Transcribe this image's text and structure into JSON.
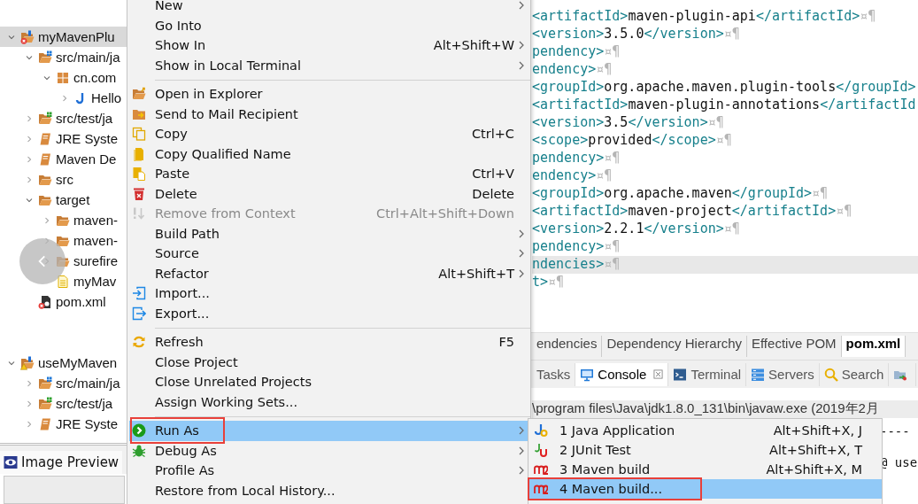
{
  "project_tree": [
    {
      "label": "myMavenPlu",
      "kind": "project",
      "expanded": true,
      "selected": true,
      "error": true,
      "warning": false,
      "children": [
        {
          "label": "src/main/ja",
          "kind": "source",
          "expanded": true,
          "selected": false,
          "error": false,
          "warning": false,
          "children": [
            {
              "label": "cn.com",
              "kind": "package",
              "expanded": true,
              "selected": false,
              "error": false,
              "warning": false,
              "children": [
                {
                  "label": "Hello",
                  "kind": "java",
                  "expanded": false,
                  "selected": false,
                  "error": false,
                  "warning": false
                }
              ]
            }
          ]
        },
        {
          "label": "src/test/ja",
          "kind": "test-source",
          "expanded": false,
          "selected": false,
          "error": false,
          "warning": false
        },
        {
          "label": "JRE Syste",
          "kind": "library",
          "expanded": false,
          "selected": false,
          "error": false,
          "warning": false
        },
        {
          "label": "Maven De",
          "kind": "library",
          "expanded": false,
          "selected": false,
          "error": false,
          "warning": false
        },
        {
          "label": "src",
          "kind": "folder",
          "expanded": false,
          "selected": false,
          "error": false,
          "warning": false
        },
        {
          "label": "target",
          "kind": "folder",
          "expanded": true,
          "selected": false,
          "error": false,
          "warning": false,
          "children": [
            {
              "label": "maven-",
              "kind": "folder",
              "expanded": false,
              "selected": false,
              "error": false,
              "warning": false
            },
            {
              "label": "maven-",
              "kind": "folder",
              "expanded": false,
              "selected": false,
              "error": false,
              "warning": false
            },
            {
              "label": "surefire",
              "kind": "folder",
              "expanded": false,
              "selected": false,
              "error": false,
              "warning": false
            },
            {
              "label": "myMav",
              "kind": "file",
              "selected": false,
              "error": false,
              "warning": false
            }
          ]
        },
        {
          "label": "pom.xml",
          "kind": "xml",
          "selected": false,
          "error": true,
          "warning": false
        }
      ]
    },
    {
      "label": "useMyMaven",
      "kind": "project",
      "expanded": true,
      "selected": false,
      "error": false,
      "warning": true,
      "children": [
        {
          "label": "src/main/ja",
          "kind": "source",
          "expanded": false,
          "selected": false,
          "error": false,
          "warning": false
        },
        {
          "label": "src/test/ja",
          "kind": "test-source",
          "expanded": false,
          "selected": false,
          "error": false,
          "warning": false
        },
        {
          "label": "JRE Syste",
          "kind": "library",
          "expanded": false,
          "selected": false,
          "error": false,
          "warning": false
        }
      ]
    }
  ],
  "preview_tab": {
    "label": "Image Preview"
  },
  "editor": {
    "lines": [
      {
        "code": "<artifactId>maven-plugin-api</artifactId>¤¶",
        "current": false
      },
      {
        "code": "<version>3.5.0</version>¤¶",
        "current": false
      },
      {
        "code": "pendency>¤¶",
        "current": false
      },
      {
        "code": "endency>¤¶",
        "current": false
      },
      {
        "code": "<groupId>org.apache.maven.plugin-tools</groupId>",
        "current": false
      },
      {
        "code": "<artifactId>maven-plugin-annotations</artifactId",
        "current": false
      },
      {
        "code": "<version>3.5</version>¤¶",
        "current": false
      },
      {
        "code": "<scope>provided</scope>¤¶",
        "current": false
      },
      {
        "code": "pendency>¤¶",
        "current": false
      },
      {
        "code": "endency>¤¶",
        "current": false
      },
      {
        "code": "<groupId>org.apache.maven</groupId>¤¶",
        "current": false
      },
      {
        "code": "<artifactId>maven-project</artifactId>¤¶",
        "current": false
      },
      {
        "code": "<version>2.2.1</version>¤¶",
        "current": false
      },
      {
        "code": "pendency>¤¶",
        "current": false
      },
      {
        "code": "ndencies>¤¶",
        "current": true
      },
      {
        "code": "t>¤¶",
        "current": false
      }
    ]
  },
  "editor_tabs": [
    {
      "label": "endencies",
      "selected": false
    },
    {
      "label": "Dependency Hierarchy",
      "selected": false
    },
    {
      "label": "Effective POM",
      "selected": false
    },
    {
      "label": "pom.xml",
      "selected": true
    }
  ],
  "view_tabs": [
    {
      "kind": "plain",
      "label": "Tasks",
      "selected": false,
      "closable": false
    },
    {
      "kind": "console",
      "label": "Console",
      "selected": true,
      "closable": true
    },
    {
      "kind": "terminal",
      "label": "Terminal",
      "selected": false,
      "closable": false
    },
    {
      "kind": "servers",
      "label": "Servers",
      "selected": false,
      "closable": false
    },
    {
      "kind": "search",
      "label": "Search",
      "selected": false,
      "closable": false
    },
    {
      "kind": "panel",
      "selected": false,
      "closable": false
    }
  ],
  "console": {
    "title": "\\program files\\Java\\jdk1.8.0_131\\bin\\javaw.exe (2019年2月",
    "lines": [
      "----",
      "@ use"
    ]
  },
  "context_menu": {
    "items": [
      {
        "kind": "plain",
        "label": "New",
        "submenu": true,
        "disabled": false,
        "selected": false,
        "marked": false
      },
      {
        "kind": "plain",
        "label": "Go Into",
        "submenu": false,
        "disabled": false,
        "selected": false,
        "marked": false
      },
      {
        "kind": "plain",
        "label": "Show In",
        "shortcut": "Alt+Shift+W",
        "submenu": true,
        "disabled": false,
        "selected": false,
        "marked": false
      },
      {
        "kind": "plain",
        "label": "Show in Local Terminal",
        "submenu": true,
        "disabled": false,
        "selected": false,
        "marked": false
      },
      {
        "kind": "separator"
      },
      {
        "kind": "open-folder",
        "label": "Open in Explorer",
        "submenu": false,
        "disabled": false,
        "selected": false,
        "marked": false
      },
      {
        "kind": "mail-folder",
        "label": "Send to Mail Recipient",
        "submenu": false,
        "disabled": false,
        "selected": false,
        "marked": false
      },
      {
        "kind": "copy",
        "label": "Copy",
        "shortcut": "Ctrl+C",
        "submenu": false,
        "disabled": false,
        "selected": false,
        "marked": false
      },
      {
        "kind": "copy-name",
        "label": "Copy Qualified Name",
        "submenu": false,
        "disabled": false,
        "selected": false,
        "marked": false
      },
      {
        "kind": "paste",
        "label": "Paste",
        "shortcut": "Ctrl+V",
        "submenu": false,
        "disabled": false,
        "selected": false,
        "marked": false
      },
      {
        "kind": "delete",
        "label": "Delete",
        "shortcut": "Delete",
        "submenu": false,
        "disabled": false,
        "selected": false,
        "marked": false
      },
      {
        "kind": "remove",
        "label": "Remove from Context",
        "shortcut": "Ctrl+Alt+Shift+Down",
        "submenu": false,
        "disabled": true,
        "selected": false,
        "marked": false
      },
      {
        "kind": "plain",
        "label": "Build Path",
        "submenu": true,
        "disabled": false,
        "selected": false,
        "marked": false
      },
      {
        "kind": "plain",
        "label": "Source",
        "submenu": true,
        "disabled": false,
        "selected": false,
        "marked": false
      },
      {
        "kind": "plain",
        "label": "Refactor",
        "shortcut": "Alt+Shift+T",
        "submenu": true,
        "disabled": false,
        "selected": false,
        "marked": false
      },
      {
        "kind": "import",
        "label": "Import...",
        "submenu": false,
        "disabled": false,
        "selected": false,
        "marked": false
      },
      {
        "kind": "export",
        "label": "Export...",
        "submenu": false,
        "disabled": false,
        "selected": false,
        "marked": false
      },
      {
        "kind": "separator"
      },
      {
        "kind": "refresh",
        "label": "Refresh",
        "shortcut": "F5",
        "submenu": false,
        "disabled": false,
        "selected": false,
        "marked": false
      },
      {
        "kind": "plain",
        "label": "Close Project",
        "submenu": false,
        "disabled": false,
        "selected": false,
        "marked": false
      },
      {
        "kind": "plain",
        "label": "Close Unrelated Projects",
        "submenu": false,
        "disabled": false,
        "selected": false,
        "marked": false
      },
      {
        "kind": "plain",
        "label": "Assign Working Sets...",
        "submenu": false,
        "disabled": false,
        "selected": false,
        "marked": false
      },
      {
        "kind": "separator"
      },
      {
        "kind": "run",
        "label": "Run As",
        "submenu": true,
        "disabled": false,
        "selected": true,
        "marked": true
      },
      {
        "kind": "debug",
        "label": "Debug As",
        "submenu": true,
        "disabled": false,
        "selected": false,
        "marked": false
      },
      {
        "kind": "plain",
        "label": "Profile As",
        "submenu": true,
        "disabled": false,
        "selected": false,
        "marked": false
      },
      {
        "kind": "plain",
        "label": "Restore from Local History...",
        "submenu": false,
        "disabled": false,
        "selected": false,
        "marked": false
      }
    ]
  },
  "run_as_menu": {
    "items": [
      {
        "kind": "java-app",
        "label": "1 Java Application",
        "shortcut": "Alt+Shift+X, J",
        "selected": false,
        "marked": false
      },
      {
        "kind": "junit",
        "label": "2 JUnit Test",
        "shortcut": "Alt+Shift+X, T",
        "selected": false,
        "marked": false
      },
      {
        "kind": "m2",
        "label": "3 Maven build",
        "shortcut": "Alt+Shift+X, M",
        "selected": false,
        "marked": false
      },
      {
        "kind": "m2",
        "label": "4 Maven build...",
        "selected": true,
        "marked": true
      }
    ]
  }
}
